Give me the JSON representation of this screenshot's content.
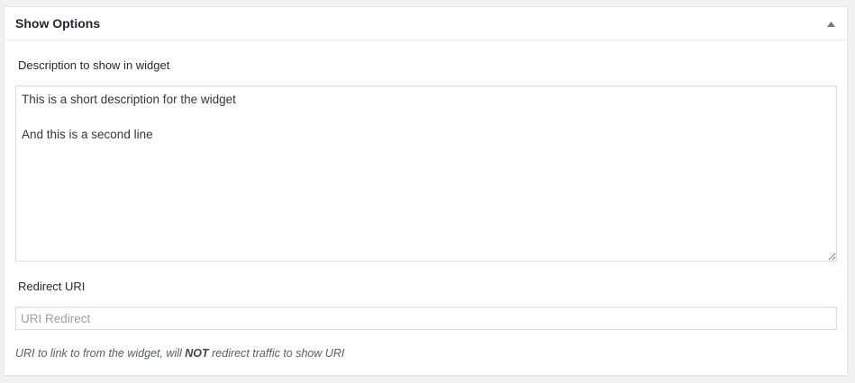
{
  "panel": {
    "title": "Show Options",
    "toggle_icon": "triangle-up-icon"
  },
  "description": {
    "label": "Description to show in widget",
    "value": "This is a short description for the widget\n\nAnd this is a second line"
  },
  "redirect": {
    "label": "Redirect URI",
    "placeholder": "URI Redirect",
    "value": ""
  },
  "help": {
    "text_before": "URI to link to from the widget, will ",
    "emphasis": "NOT",
    "text_after": " redirect traffic to show URI"
  }
}
